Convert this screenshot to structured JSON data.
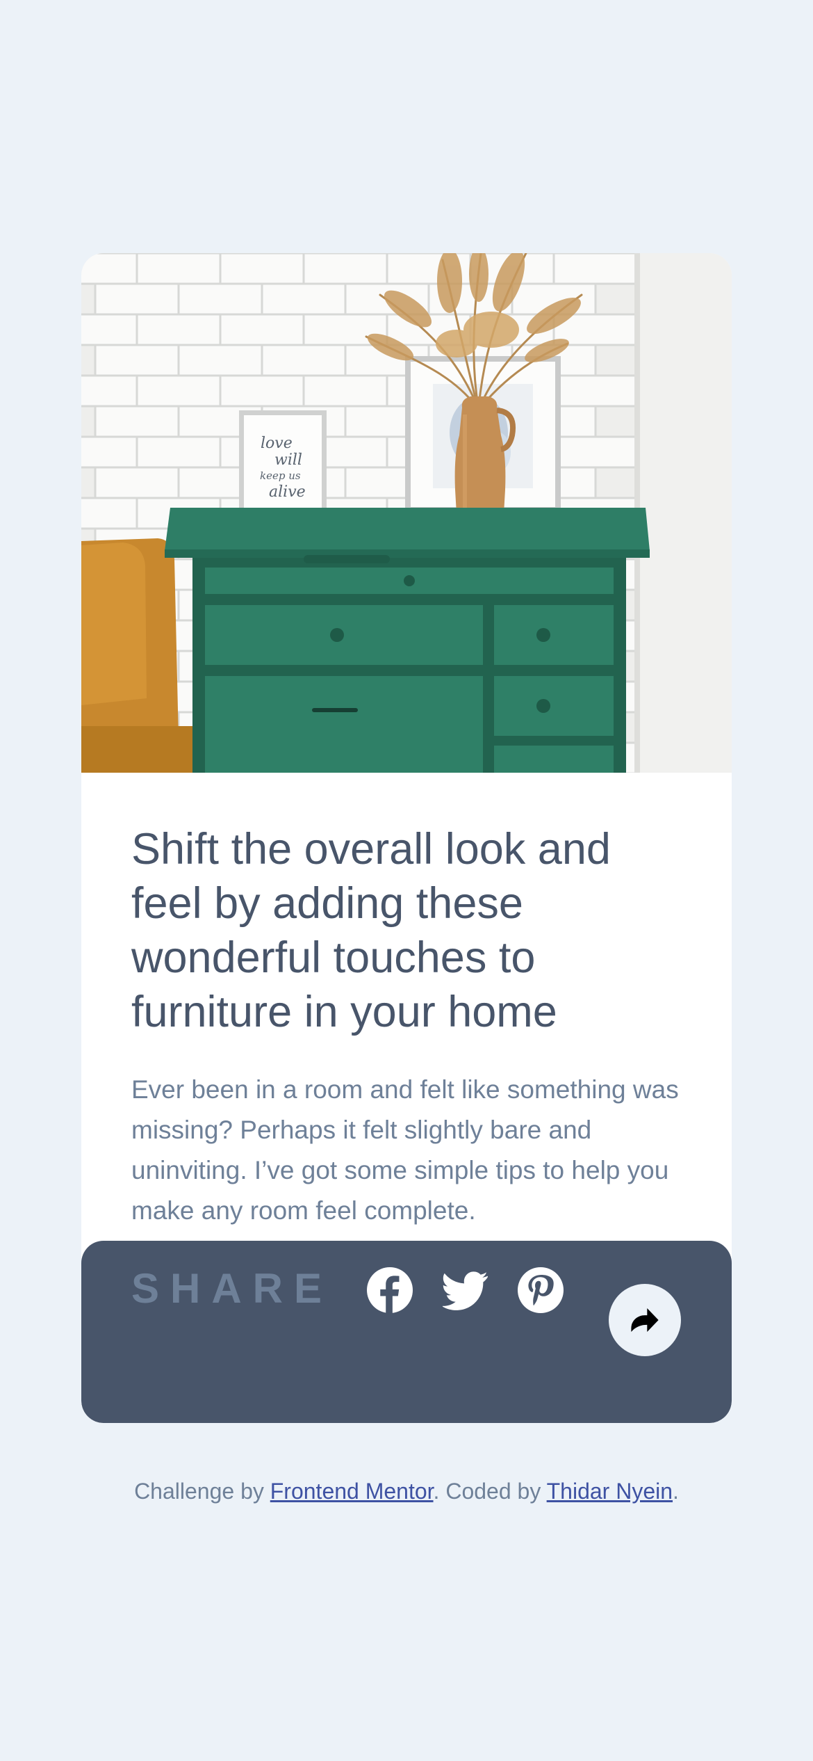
{
  "article": {
    "title": "Shift the overall look and feel by adding these wonderful touches to furniture in your home",
    "description": "Ever been in a room and felt like something was missing? Perhaps it felt slightly bare and uninviting. I’ve got some simple tips to help you make any room feel complete.",
    "image_alt": "A green drawer with pictures and a vase",
    "frame_text": [
      "love",
      "will",
      "keep us",
      "alive"
    ]
  },
  "share": {
    "label": "SHARE",
    "icons": [
      "facebook-icon",
      "twitter-icon",
      "pinterest-icon",
      "share-arrow-icon"
    ]
  },
  "attribution": {
    "prefix": "Challenge by ",
    "link1": "Frontend Mentor",
    "middle": ". Coded by ",
    "link2": "Thidar Nyein",
    "suffix": "."
  },
  "colors": {
    "background": "#ECF2F8",
    "card": "#FFFFFF",
    "heading": "#48556A",
    "text": "#6E8098",
    "share_bar": "#48556A",
    "link": "#3E52A3"
  }
}
